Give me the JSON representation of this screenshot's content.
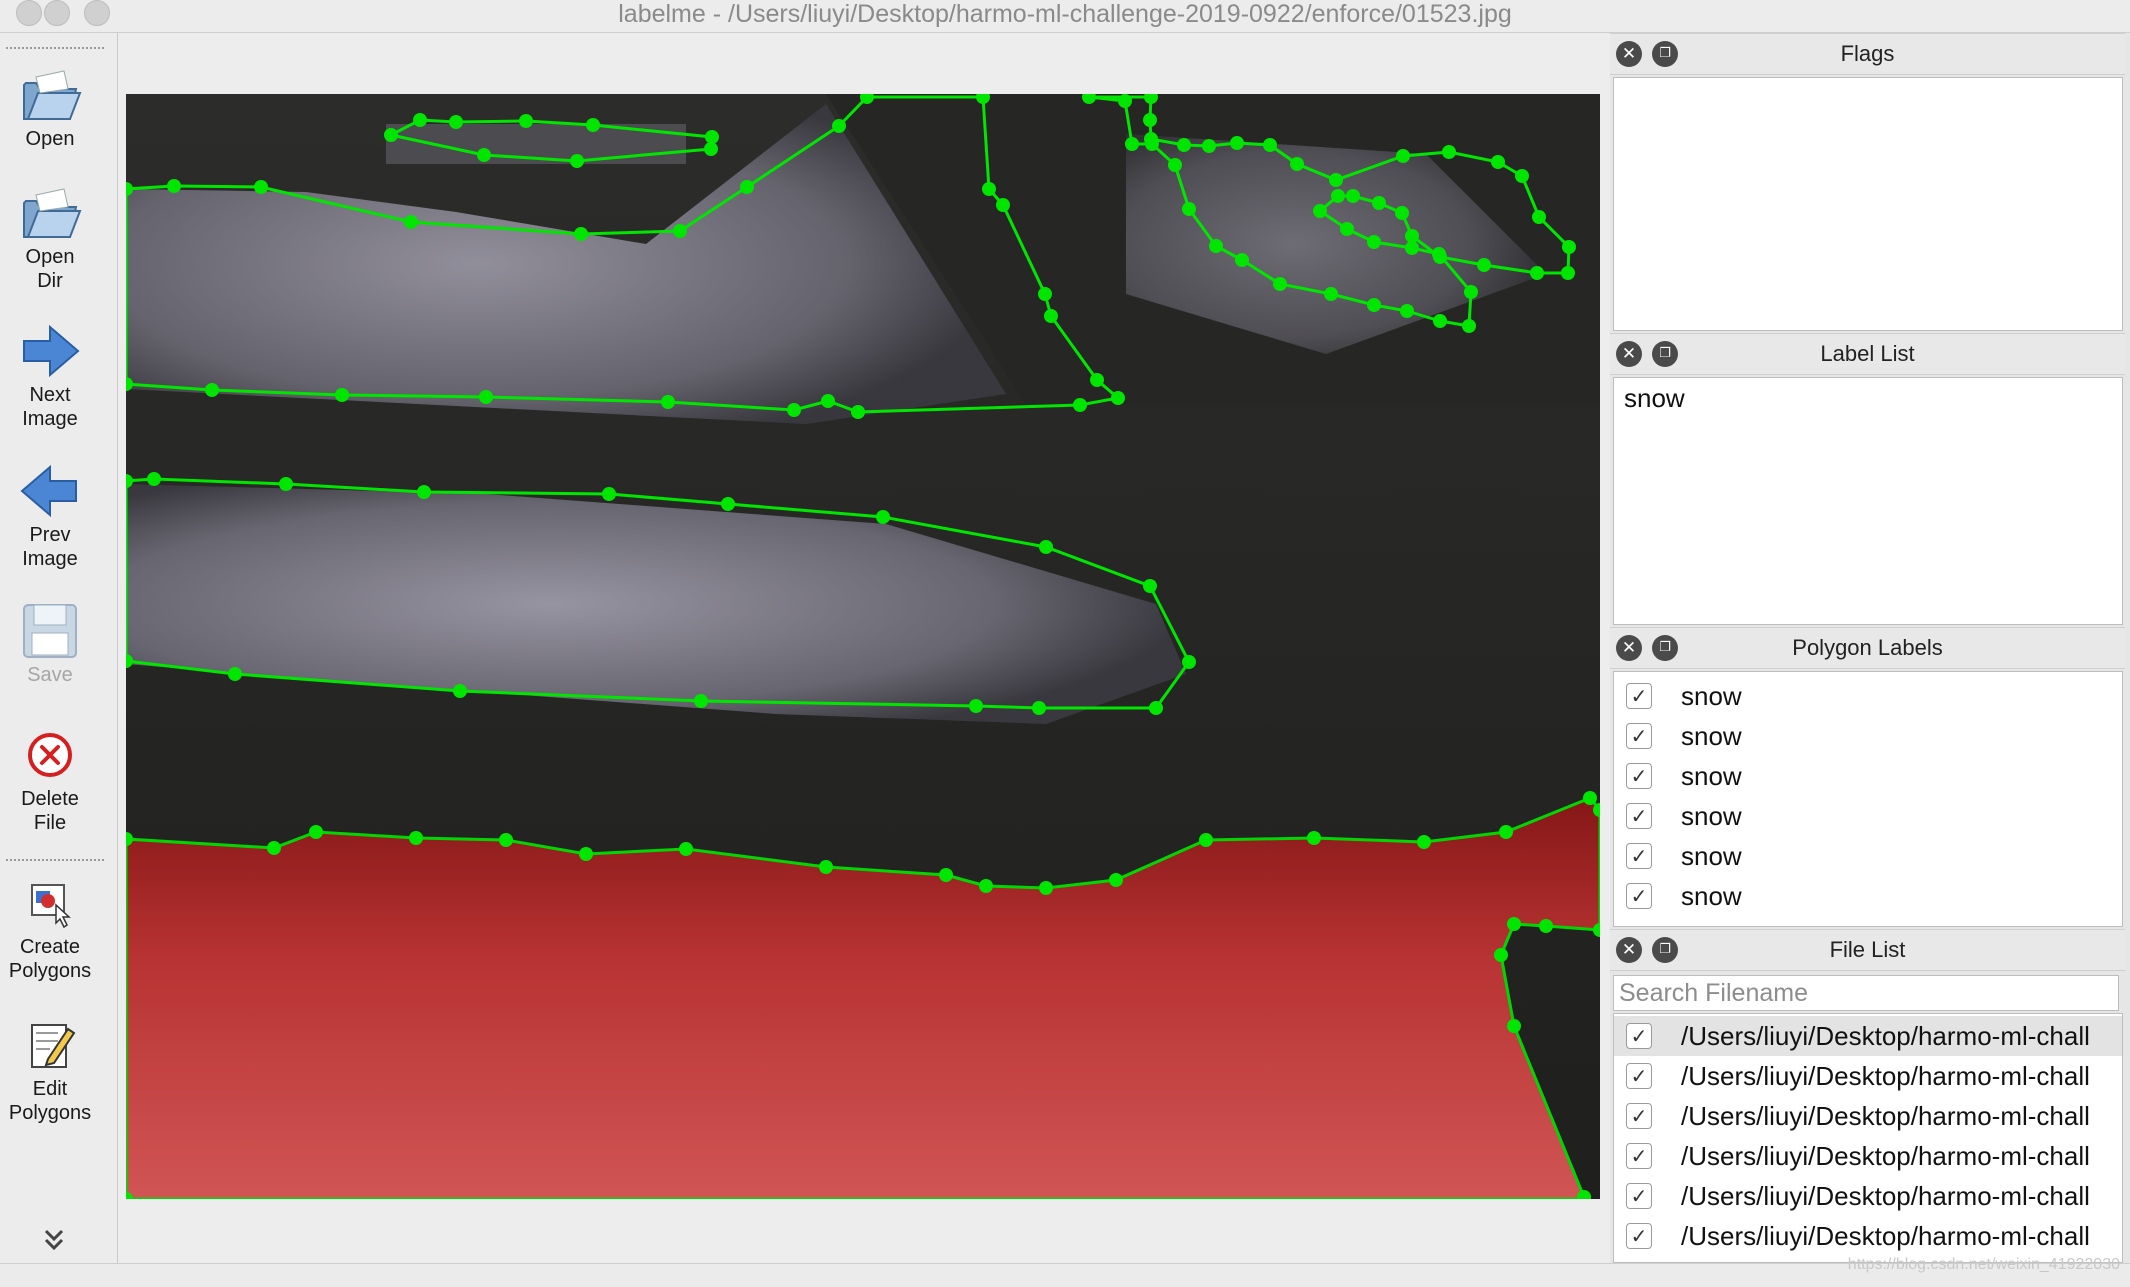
{
  "window": {
    "title": "labelme - /Users/liuyi/Desktop/harmo-ml-challenge-2019-0922/enforce/01523.jpg"
  },
  "toolbar": {
    "items": [
      {
        "label": "Open",
        "icon": "folder-open-icon",
        "enabled": true
      },
      {
        "label": "Open\nDir",
        "icon": "folder-open-icon",
        "enabled": true
      },
      {
        "label": "Next\nImage",
        "icon": "arrow-right-icon",
        "enabled": true
      },
      {
        "label": "Prev\nImage",
        "icon": "arrow-left-icon",
        "enabled": true
      },
      {
        "label": "Save",
        "icon": "floppy-disk-icon",
        "enabled": false
      },
      {
        "label": "Delete\nFile",
        "icon": "delete-circle-icon",
        "enabled": true
      },
      {
        "label": "Create\nPolygons",
        "icon": "create-polygon-icon",
        "enabled": true
      },
      {
        "label": "Edit\nPolygons",
        "icon": "edit-polygon-icon",
        "enabled": true
      }
    ],
    "overflow_icon": "chevron-double-down-icon"
  },
  "canvas": {
    "polygon_color": "#00e600",
    "fill_color": "#e03232",
    "selected_label": "snow"
  },
  "panels": {
    "flags": {
      "title": "Flags"
    },
    "label_list": {
      "title": "Label List",
      "items": [
        "snow"
      ]
    },
    "polygon_labels": {
      "title": "Polygon Labels",
      "items": [
        "snow",
        "snow",
        "snow",
        "snow",
        "snow",
        "snow"
      ]
    },
    "file_list": {
      "title": "File List",
      "search_placeholder": "Search Filename",
      "items": [
        "/Users/liuyi/Desktop/harmo-ml-chall",
        "/Users/liuyi/Desktop/harmo-ml-chall",
        "/Users/liuyi/Desktop/harmo-ml-chall",
        "/Users/liuyi/Desktop/harmo-ml-chall",
        "/Users/liuyi/Desktop/harmo-ml-chall",
        "/Users/liuyi/Desktop/harmo-ml-chall"
      ]
    }
  },
  "watermark": "https://blog.csdn.net/weixin_41922030"
}
